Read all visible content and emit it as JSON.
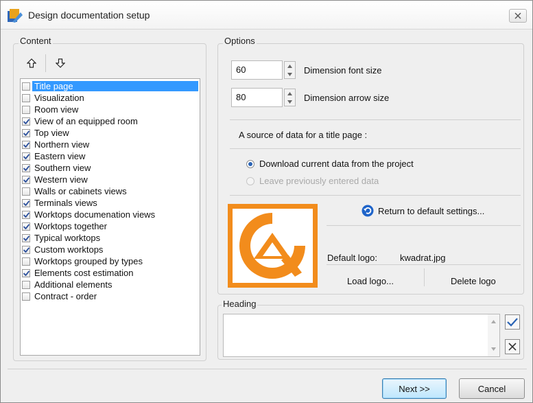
{
  "window": {
    "title": "Design documentation setup"
  },
  "content": {
    "label": "Content",
    "items": [
      {
        "label": "Title page",
        "checked": false,
        "selected": true
      },
      {
        "label": "Visualization",
        "checked": false
      },
      {
        "label": "Room view",
        "checked": false
      },
      {
        "label": "View of an equipped room",
        "checked": true
      },
      {
        "label": "Top view",
        "checked": true
      },
      {
        "label": "Northern view",
        "checked": true
      },
      {
        "label": "Eastern view",
        "checked": true
      },
      {
        "label": "Southern view",
        "checked": true
      },
      {
        "label": "Western view",
        "checked": true
      },
      {
        "label": "Walls or cabinets views",
        "checked": false
      },
      {
        "label": "Terminals views",
        "checked": true
      },
      {
        "label": "Worktops documenation views",
        "checked": true
      },
      {
        "label": "Worktops together",
        "checked": true
      },
      {
        "label": "Typical worktops",
        "checked": true
      },
      {
        "label": "Custom worktops",
        "checked": true
      },
      {
        "label": "Worktops grouped by types",
        "checked": false
      },
      {
        "label": "Elements cost estimation",
        "checked": true
      },
      {
        "label": "Additional elements",
        "checked": false
      },
      {
        "label": "Contract - order",
        "checked": false
      }
    ]
  },
  "options": {
    "label": "Options",
    "font_size": {
      "value": "60",
      "label": "Dimension font size"
    },
    "arrow_size": {
      "value": "80",
      "label": "Dimension arrow size"
    },
    "source_label": "A source of data for a title page :",
    "radio_download": "Download current data from the project",
    "radio_leave": "Leave previously entered data",
    "return_default": "Return to default settings...",
    "default_logo_label": "Default logo:",
    "default_logo_file": "kwadrat.jpg",
    "load_logo": "Load logo...",
    "delete_logo": "Delete logo"
  },
  "heading": {
    "label": "Heading",
    "value": ""
  },
  "footer": {
    "next": "Next >>",
    "cancel": "Cancel"
  },
  "colors": {
    "accent": "#3399ff",
    "logo": "#f28c1c"
  }
}
